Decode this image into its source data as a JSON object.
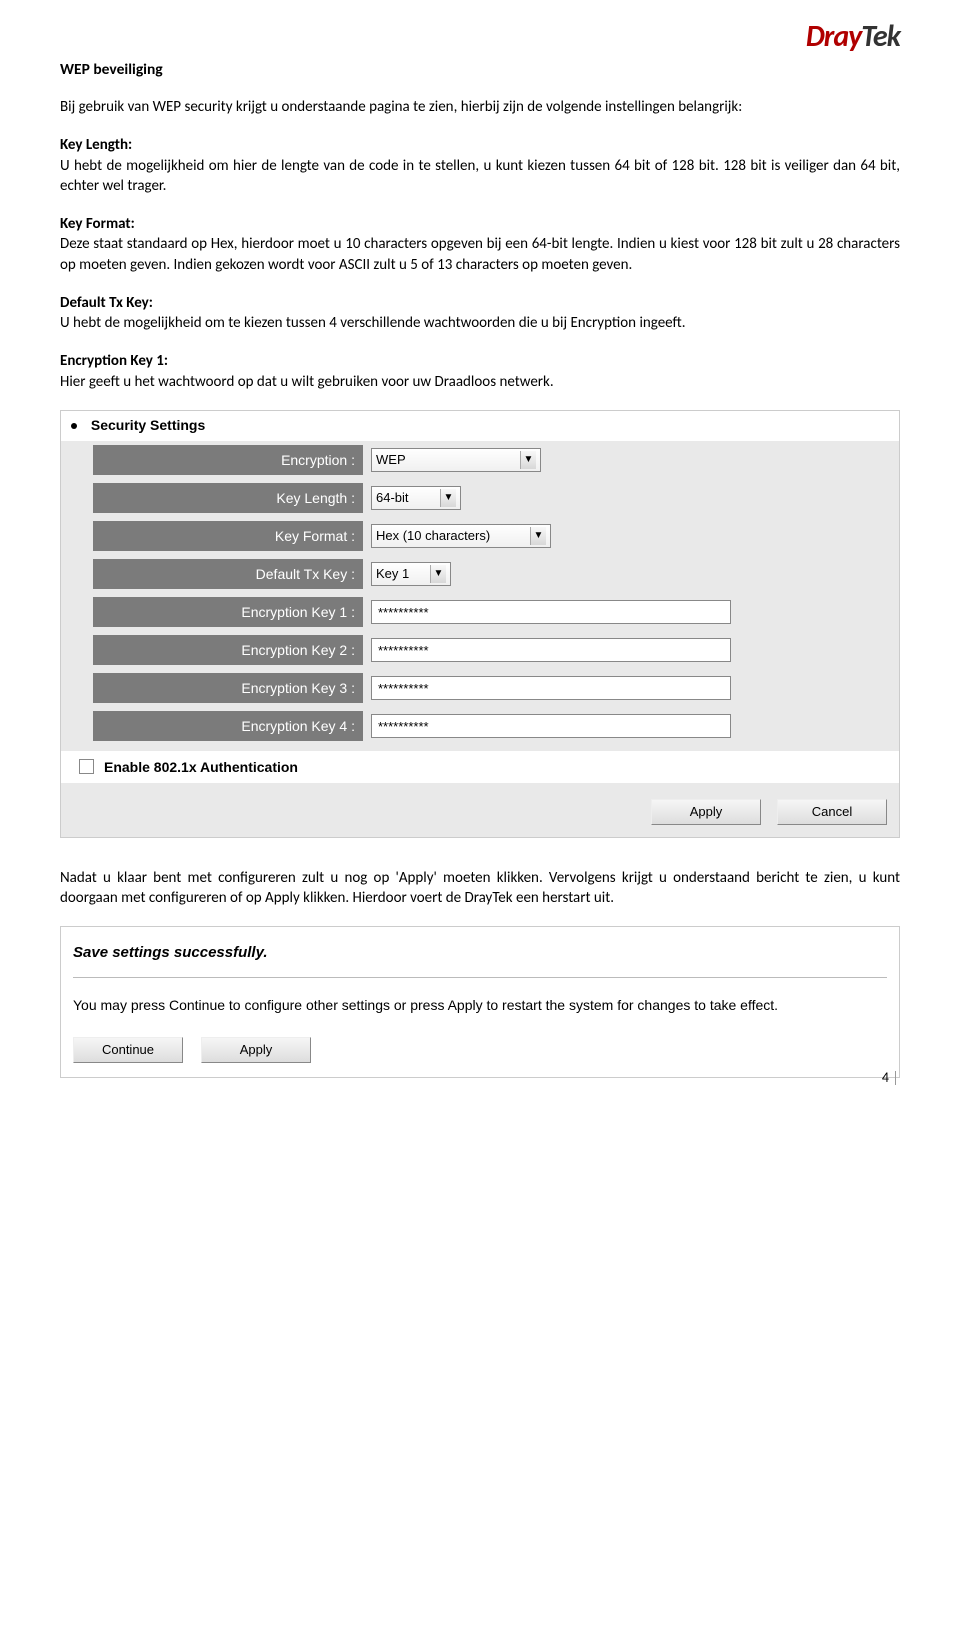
{
  "logo": {
    "part1": "Dray",
    "part2": "Tek"
  },
  "title": "WEP beveiliging",
  "intro": "Bij gebruik van WEP security krijgt u onderstaande pagina te zien, hierbij zijn de volgende instellingen belangrijk:",
  "sections": {
    "key_length": {
      "label": "Key Length:",
      "text": "U hebt de mogelijkheid om hier de lengte van de code in te stellen, u kunt kiezen tussen 64 bit of 128 bit. 128 bit is veiliger dan 64 bit, echter wel trager."
    },
    "key_format": {
      "label": "Key Format:",
      "text": "Deze staat standaard op Hex, hierdoor moet u 10 characters opgeven bij een 64-bit lengte. Indien u kiest voor 128 bit zult u 28 characters op moeten geven. Indien gekozen wordt voor ASCII zult u 5 of 13 characters op moeten geven."
    },
    "default_tx": {
      "label": "Default Tx Key:",
      "text": "U hebt de mogelijkheid om te kiezen tussen 4 verschillende wachtwoorden die u bij Encryption ingeeft."
    },
    "enc_key1": {
      "label": "Encryption Key 1:",
      "text": "Hier geeft u het wachtwoord op dat u wilt gebruiken voor uw Draadloos netwerk."
    }
  },
  "settings": {
    "section_title": "Security Settings",
    "rows": {
      "encryption": {
        "label": "Encryption :",
        "value": "WEP"
      },
      "key_length": {
        "label": "Key Length :",
        "value": "64-bit"
      },
      "key_format": {
        "label": "Key Format :",
        "value": "Hex (10 characters)"
      },
      "default_tx": {
        "label": "Default Tx Key :",
        "value": "Key 1"
      },
      "key1": {
        "label": "Encryption Key 1 :",
        "value": "**********"
      },
      "key2": {
        "label": "Encryption Key 2 :",
        "value": "**********"
      },
      "key3": {
        "label": "Encryption Key 3 :",
        "value": "**********"
      },
      "key4": {
        "label": "Encryption Key 4 :",
        "value": "**********"
      }
    },
    "enable_8021x": "Enable 802.1x Authentication",
    "buttons": {
      "apply": "Apply",
      "cancel": "Cancel"
    }
  },
  "after_text": "Nadat u klaar bent met configureren zult u nog op 'Apply' moeten klikken. Vervolgens krijgt u onderstaand bericht te zien, u kunt doorgaan met configureren of op Apply klikken. Hierdoor voert de DrayTek een herstart uit.",
  "save": {
    "title": "Save settings successfully.",
    "text": "You may press Continue to configure other settings or press Apply to restart the system for changes to take effect.",
    "buttons": {
      "continue": "Continue",
      "apply": "Apply"
    }
  },
  "page_number": "4"
}
